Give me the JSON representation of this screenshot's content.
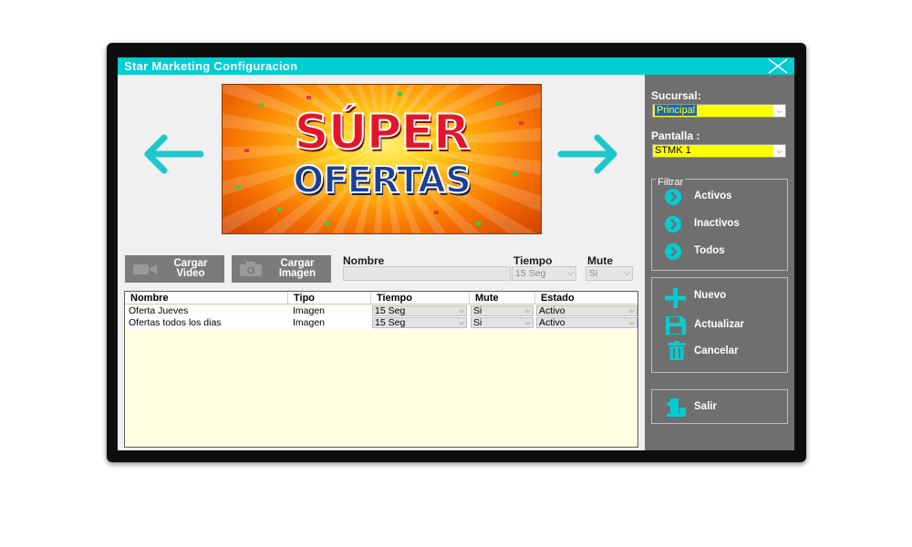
{
  "window": {
    "title": "Star Marketing Configuracion"
  },
  "banner": {
    "line1": "SÚPER",
    "line2": "OFERTAS"
  },
  "media": {
    "video_label_1": "Cargar",
    "video_label_2": "Video",
    "image_label_1": "Cargar",
    "image_label_2": "Imagen"
  },
  "form": {
    "nombre_label": "Nombre",
    "nombre_value": "",
    "tiempo_label": "Tiempo",
    "tiempo_value": "15 Seg",
    "mute_label": "Mute",
    "mute_value": "Si"
  },
  "grid": {
    "columns": [
      "Nombre",
      "Tipo",
      "Tiempo",
      "Mute",
      "Estado"
    ],
    "rows": [
      {
        "nombre": "Oferta Jueves",
        "tipo": "Imagen",
        "tiempo": "15 Seg",
        "mute": "Si",
        "estado": "Activo"
      },
      {
        "nombre": "Ofertas todos los dias",
        "tipo": "Imagen",
        "tiempo": "15 Seg",
        "mute": "Si",
        "estado": "Activo"
      }
    ]
  },
  "side": {
    "sucursal_label": "Sucursal:",
    "sucursal_value": "Principal",
    "pantalla_label": "Pantalla :",
    "pantalla_value": "STMK 1",
    "filtrar_label": "Filtrar",
    "filter_activos": "Activos",
    "filter_inactivos": "Inactivos",
    "filter_todos": "Todos",
    "nuevo": "Nuevo",
    "actualizar": "Actualizar",
    "cancelar": "Cancelar",
    "salir": "Salir"
  },
  "colors": {
    "accent": "#00cdd2",
    "side_panel": "#6f6f6f",
    "combo_highlight": "#ffff00",
    "grid_background": "#ffffe1"
  },
  "icons": {
    "close": "close-icon",
    "prev": "arrow-left-icon",
    "next": "arrow-right-icon",
    "video": "video-camera-icon",
    "image": "photo-camera-icon",
    "filter": "chevron-circle-icon",
    "nuevo": "plus-icon",
    "actualizar": "save-icon",
    "cancelar": "trash-icon",
    "salir": "exit-door-icon"
  }
}
